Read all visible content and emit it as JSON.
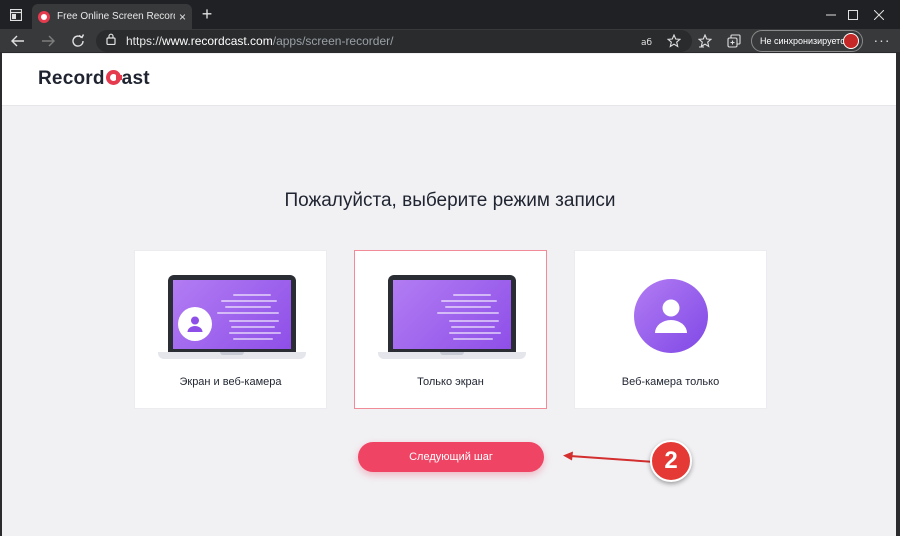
{
  "browser": {
    "tab_title": "Free Online Screen Recorder - R",
    "url_scheme": "https://",
    "url_host": "www.recordcast.com",
    "url_path": "/apps/screen-recorder/",
    "sync_label": "Не синхронизируется",
    "more_label": "···",
    "new_tab_label": "+",
    "close_tab_label": "×"
  },
  "site": {
    "logo_left": "Record",
    "logo_right": "ast",
    "brand_color": "#e53b4f"
  },
  "main": {
    "heading": "Пожалуйста, выберите режим записи",
    "cards": [
      {
        "label": "Экран и веб-камера",
        "selected": false,
        "icon": "laptop-webcam-icon"
      },
      {
        "label": "Только экран",
        "selected": true,
        "icon": "laptop-icon"
      },
      {
        "label": "Веб-камера только",
        "selected": false,
        "icon": "webcam-user-icon"
      }
    ],
    "next_button": "Следующий шаг",
    "accent_color": "#ef4464"
  },
  "annotation": {
    "badge_number": "2",
    "badge_color": "#e53935"
  }
}
